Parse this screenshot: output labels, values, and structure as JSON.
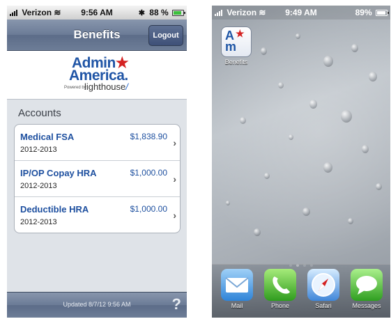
{
  "left_screen": {
    "status_bar": {
      "carrier": "Verizon",
      "time": "9:56 AM",
      "battery": "88 %",
      "battery_level": 0.88
    },
    "nav": {
      "title": "Benefits",
      "logout_label": "Logout"
    },
    "logo": {
      "line1": "Admin",
      "line2": "America.",
      "powered_by": "Powered by",
      "brand": "lighthouse"
    },
    "section_header": "Accounts",
    "accounts": [
      {
        "name": "Medical FSA",
        "year": "2012-2013",
        "amount": "$1,838.90"
      },
      {
        "name": "IP/OP Copay HRA",
        "year": "2012-2013",
        "amount": "$1,000.00"
      },
      {
        "name": "Deductible HRA",
        "year": "2012-2013",
        "amount": "$1,000.00"
      }
    ],
    "footer": {
      "updated": "Updated 8/7/12 9:56 AM",
      "help": "?"
    }
  },
  "right_screen": {
    "status_bar": {
      "carrier": "Verizon",
      "time": "9:49 AM",
      "battery": "89%",
      "battery_level": 0.89
    },
    "app": {
      "icon": "admin-america-app-icon",
      "label": "Benefits"
    },
    "dock": [
      {
        "label": "Mail",
        "icon": "mail-icon"
      },
      {
        "label": "Phone",
        "icon": "phone-icon"
      },
      {
        "label": "Safari",
        "icon": "safari-icon"
      },
      {
        "label": "Messages",
        "icon": "messages-icon"
      }
    ]
  },
  "colors": {
    "nav_blue": "#6b7b96",
    "brand_blue": "#2055a6",
    "brand_red": "#d42222"
  }
}
